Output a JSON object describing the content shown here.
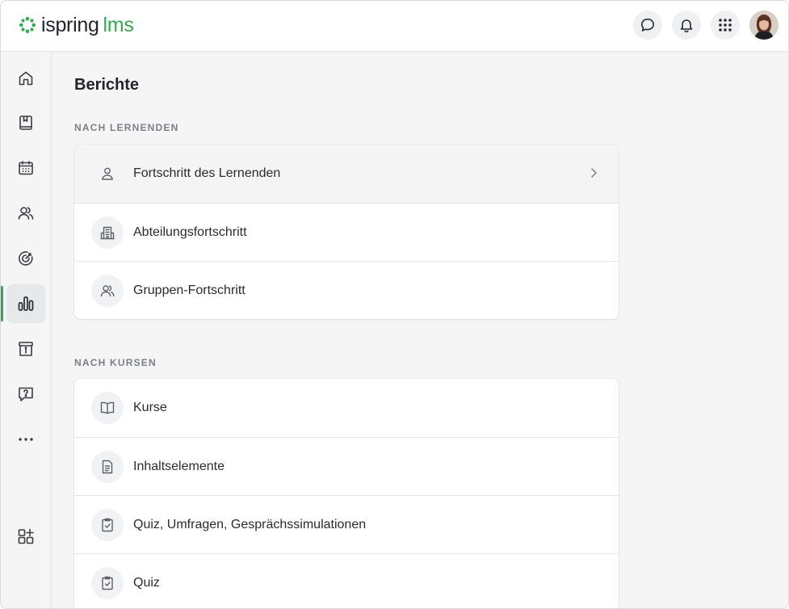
{
  "app": {
    "logo_part1": "ispring",
    "logo_part2": "lms",
    "brand_color": "#34a853"
  },
  "header": {
    "actions": [
      {
        "name": "chat-button",
        "icon": "chat-bubble-icon"
      },
      {
        "name": "notifications-button",
        "icon": "bell-icon"
      },
      {
        "name": "apps-button",
        "icon": "apps-grid-icon"
      }
    ],
    "avatar": "user-avatar"
  },
  "sidebar": {
    "items": [
      {
        "icon": "home-icon"
      },
      {
        "icon": "book-icon"
      },
      {
        "icon": "calendar-icon"
      },
      {
        "icon": "users-icon"
      },
      {
        "icon": "target-icon"
      },
      {
        "icon": "reports-chart-icon",
        "active": true
      },
      {
        "icon": "info-archive-icon"
      },
      {
        "icon": "help-chat-icon"
      },
      {
        "icon": "more-icon"
      },
      {
        "icon": "add-widget-icon"
      }
    ]
  },
  "main": {
    "title": "Berichte",
    "sections": [
      {
        "label": "NACH LERNENDEN",
        "items": [
          {
            "label": "Fortschritt des Lernenden",
            "icon": "person-icon"
          },
          {
            "label": "Abteilungsfortschritt",
            "icon": "building-icon"
          },
          {
            "label": "Gruppen-Fortschritt",
            "icon": "group-icon"
          }
        ]
      },
      {
        "label": "NACH KURSEN",
        "items": [
          {
            "label": "Kurse",
            "icon": "open-book-icon"
          },
          {
            "label": "Inhaltselemente",
            "icon": "document-icon"
          },
          {
            "label": "Quiz, Umfragen, Gesprächssimulationen",
            "icon": "checklist-icon"
          },
          {
            "label": "Quiz",
            "icon": "checklist-icon"
          }
        ]
      }
    ]
  }
}
